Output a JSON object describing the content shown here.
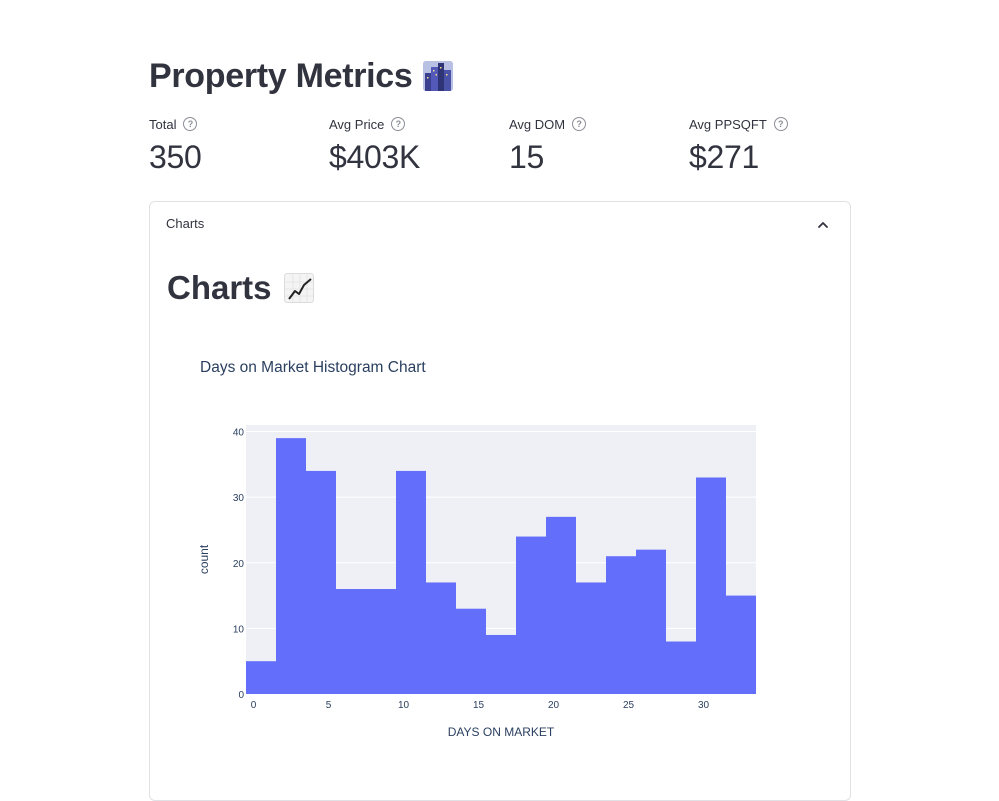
{
  "page_title": "Property Metrics",
  "metrics": [
    {
      "label": "Total",
      "value": "350"
    },
    {
      "label": "Avg Price",
      "value": "$403K"
    },
    {
      "label": "Avg DOM",
      "value": "15"
    },
    {
      "label": "Avg PPSQFT",
      "value": "$271"
    }
  ],
  "expander": {
    "label": "Charts",
    "expanded": true
  },
  "section_title": "Charts",
  "icons": {
    "title_emoji": "cityscape-icon",
    "section_emoji": "chart-increasing-icon",
    "help": "question-circle-icon",
    "collapse": "chevron-up-icon"
  },
  "colors": {
    "bar": "#636efa",
    "plot_bg": "#eff0f6",
    "grid": "#ffffff"
  },
  "chart_data": {
    "type": "bar",
    "title": "Days on Market Histogram Chart",
    "xlabel": "DAYS ON MARKET",
    "ylabel": "count",
    "bin_width": 2,
    "x": [
      0,
      2,
      4,
      6,
      8,
      10,
      12,
      14,
      16,
      18,
      20,
      22,
      24,
      26,
      28,
      30,
      32
    ],
    "values": [
      5,
      39,
      34,
      16,
      16,
      34,
      17,
      13,
      9,
      24,
      27,
      17,
      21,
      22,
      8,
      33,
      15
    ],
    "xlim": [
      -0.5,
      33.5
    ],
    "ylim": [
      0,
      41
    ],
    "x_ticks": [
      0,
      5,
      10,
      15,
      20,
      25,
      30
    ],
    "y_ticks": [
      0,
      10,
      20,
      30,
      40
    ],
    "grid": true
  }
}
